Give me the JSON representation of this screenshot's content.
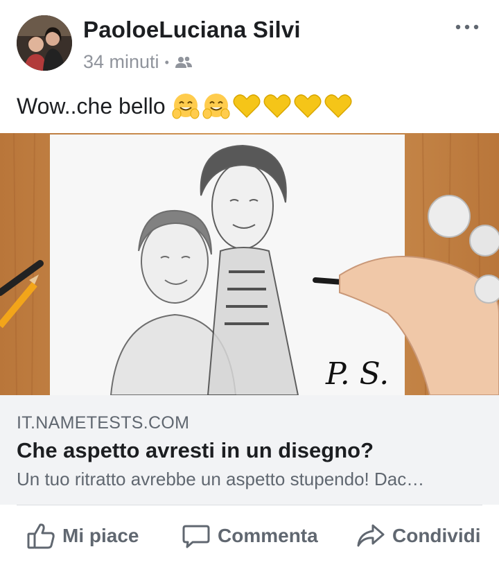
{
  "post": {
    "author": "PaoloeLuciana Silvi",
    "time": "34 minuti",
    "separator": "•",
    "audience_icon": "friends-icon",
    "text": "Wow..che bello",
    "emojis": [
      "hugging-face-emoji",
      "hugging-face-emoji",
      "yellow-heart-emoji",
      "yellow-heart-emoji",
      "yellow-heart-emoji",
      "yellow-heart-emoji"
    ]
  },
  "link": {
    "domain": "IT.NAMETESTS.COM",
    "title": "Che aspetto avresti in un disegno?",
    "description": "Un tuo ritratto avrebbe un aspetto stupendo! Dac…",
    "signature": "P. S."
  },
  "actions": {
    "like": "Mi piace",
    "comment": "Commenta",
    "share": "Condividi"
  },
  "colors": {
    "text": "#1c1e21",
    "secondary": "#606770",
    "meta": "#90949c",
    "card_bg": "#f2f3f5",
    "heart": "#f5c518"
  }
}
